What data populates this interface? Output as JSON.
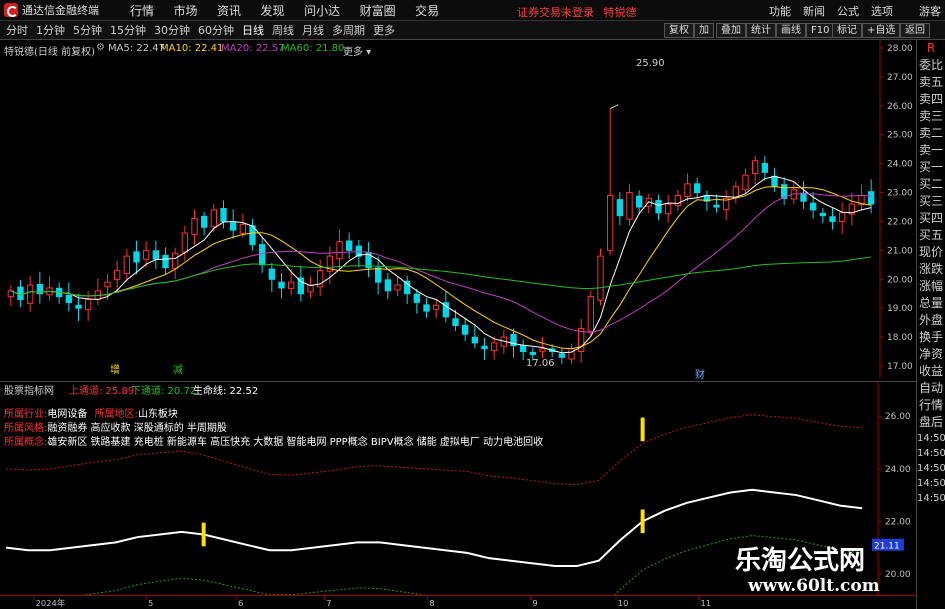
{
  "app": {
    "title": "通达信金融终端",
    "menu": [
      "行情",
      "市场",
      "资讯",
      "发现",
      "问小达",
      "财富圈",
      "交易"
    ],
    "login_notice": "证券交易未登录",
    "stock_name_top": "特锐德",
    "right_menu": [
      "功能",
      "新闻",
      "公式",
      "选项",
      "游客"
    ]
  },
  "toolbar": {
    "periods": [
      "分时",
      "1分钟",
      "5分钟",
      "15分钟",
      "30分钟",
      "60分钟",
      "日线",
      "周线",
      "月线",
      "多周期",
      "更多"
    ],
    "active_period": "日线",
    "buttons": [
      "复权",
      "加",
      "叠加",
      "统计",
      "画线",
      "F10",
      "标记",
      "+自选",
      "返回"
    ]
  },
  "main_chart": {
    "header_name": "特锐德(日线 前复权)",
    "ma": [
      {
        "label": "MA5: 22.47",
        "color": "#ffffff"
      },
      {
        "label": "MA10: 22.41",
        "color": "#ffd700"
      },
      {
        "label": "MA20: 22.57",
        "color": "#c040c0"
      },
      {
        "label": "MA60: 21.80",
        "color": "#20c020"
      }
    ],
    "high_label": "25.90",
    "low_label": "17.06",
    "marks": [
      {
        "text": "增",
        "color": "#ffd700"
      },
      {
        "text": "减",
        "color": "#20c020"
      },
      {
        "text": "财",
        "color": "#6fa8ff"
      }
    ]
  },
  "chart_data": [
    {
      "type": "candlestick",
      "title": "特锐德(日线 前复权)",
      "ylim": [
        17.0,
        28.0
      ],
      "yticks": [
        "28.00",
        "27.00",
        "26.00",
        "25.00",
        "24.00",
        "23.00",
        "22.00",
        "21.00",
        "20.00",
        "19.00",
        "18.00",
        "17.00"
      ],
      "xticks": [
        "2024年",
        "5",
        "6",
        "7",
        "8",
        "9",
        "10",
        "11"
      ],
      "close": [
        19.6,
        19.3,
        19.8,
        19.5,
        19.7,
        19.4,
        19.2,
        19.0,
        19.3,
        19.6,
        19.9,
        20.3,
        20.8,
        20.6,
        21.0,
        20.7,
        20.4,
        20.9,
        21.6,
        22.1,
        21.8,
        22.4,
        22.0,
        21.7,
        21.9,
        21.2,
        20.5,
        20.0,
        19.7,
        19.9,
        19.5,
        19.8,
        20.3,
        20.8,
        21.3,
        21.0,
        20.8,
        20.4,
        19.9,
        19.6,
        19.8,
        19.5,
        19.2,
        18.9,
        19.1,
        18.7,
        18.4,
        18.1,
        17.8,
        17.6,
        17.8,
        18.0,
        17.7,
        17.5,
        17.4,
        17.6,
        17.5,
        17.3,
        17.6,
        18.3,
        19.4,
        20.8,
        22.9,
        22.2,
        23.0,
        22.5,
        22.8,
        22.3,
        22.6,
        22.9,
        23.3,
        23.0,
        22.7,
        22.5,
        22.8,
        23.2,
        23.6,
        24.1,
        23.7,
        23.2,
        22.8,
        23.1,
        22.7,
        22.4,
        22.2,
        22.0,
        22.3,
        22.6,
        22.9,
        22.6
      ],
      "series": [
        {
          "name": "MA5",
          "last": 22.47
        },
        {
          "name": "MA10",
          "last": 22.41
        },
        {
          "name": "MA20",
          "last": 22.57
        },
        {
          "name": "MA60",
          "last": 21.8
        }
      ],
      "high": 25.9,
      "low": 17.06
    },
    {
      "type": "line",
      "title": "股票指标网",
      "ylim": [
        19.5,
        27.0
      ],
      "yticks": [
        "26.00",
        "24.00",
        "22.00",
        "20.00"
      ],
      "series": [
        {
          "name": "上通道",
          "last": 25.89
        },
        {
          "name": "下通道",
          "last": 20.72
        },
        {
          "name": "生命线",
          "last": 22.52
        }
      ],
      "life": [
        21.0,
        20.9,
        20.9,
        21.0,
        21.1,
        21.2,
        21.4,
        21.5,
        21.6,
        21.5,
        21.3,
        21.1,
        20.9,
        20.9,
        21.0,
        21.1,
        21.2,
        21.2,
        21.1,
        21.0,
        20.9,
        20.8,
        20.6,
        20.5,
        20.4,
        20.3,
        20.3,
        20.5,
        21.3,
        22.0,
        22.4,
        22.7,
        22.9,
        23.1,
        23.2,
        23.1,
        23.0,
        22.8,
        22.6,
        22.5
      ],
      "current_tag": "21.11"
    }
  ],
  "indicator": {
    "name": "股票指标网",
    "upper": "上通道: 25.89",
    "lower": "下通道: 20.72",
    "life": "生命线: 22.52",
    "info": [
      {
        "key": "所属行业:",
        "val": "电网设备",
        "key2": "所属地区:",
        "val2": "山东板块"
      },
      {
        "key": "所属风格:",
        "val": "融资融券 高应收款 深股通标的 半周期股"
      },
      {
        "key": "所属概念:",
        "val": "雄安新区 铁路基建 充电桩 新能源车 高压快充 大数据 智能电网 PPP概念 BIPV概念 储能 虚拟电厂 动力电池回收"
      }
    ]
  },
  "sidebar": [
    {
      "t": "R",
      "red": true
    },
    {
      "t": "委比",
      "red": false
    },
    {
      "t": "卖五",
      "red": false
    },
    {
      "t": "卖四",
      "red": false
    },
    {
      "t": "卖三",
      "red": false
    },
    {
      "t": "卖二",
      "red": false
    },
    {
      "t": "卖一",
      "red": false
    },
    {
      "t": "买一",
      "red": false
    },
    {
      "t": "买二",
      "red": false
    },
    {
      "t": "买三",
      "red": false
    },
    {
      "t": "买四",
      "red": false
    },
    {
      "t": "买五",
      "red": false
    },
    {
      "t": "现价",
      "red": false
    },
    {
      "t": "涨跌",
      "red": false
    },
    {
      "t": "涨幅",
      "red": false
    },
    {
      "t": "总量",
      "red": false
    },
    {
      "t": "外盘",
      "red": false
    },
    {
      "t": "换手",
      "red": false
    },
    {
      "t": "净资",
      "red": false
    },
    {
      "t": "收益",
      "red": false
    },
    {
      "t": "自动",
      "red": false
    },
    {
      "t": "行情",
      "red": false
    },
    {
      "t": "盘后",
      "red": false
    },
    {
      "t": "14:50",
      "red": false
    },
    {
      "t": "14:50",
      "red": false
    },
    {
      "t": "14:50",
      "red": false
    },
    {
      "t": "14:50",
      "red": false
    },
    {
      "t": "14:50",
      "red": false
    }
  ],
  "watermark": {
    "line1": "乐淘公式网",
    "line2": "www.60lt.com"
  }
}
